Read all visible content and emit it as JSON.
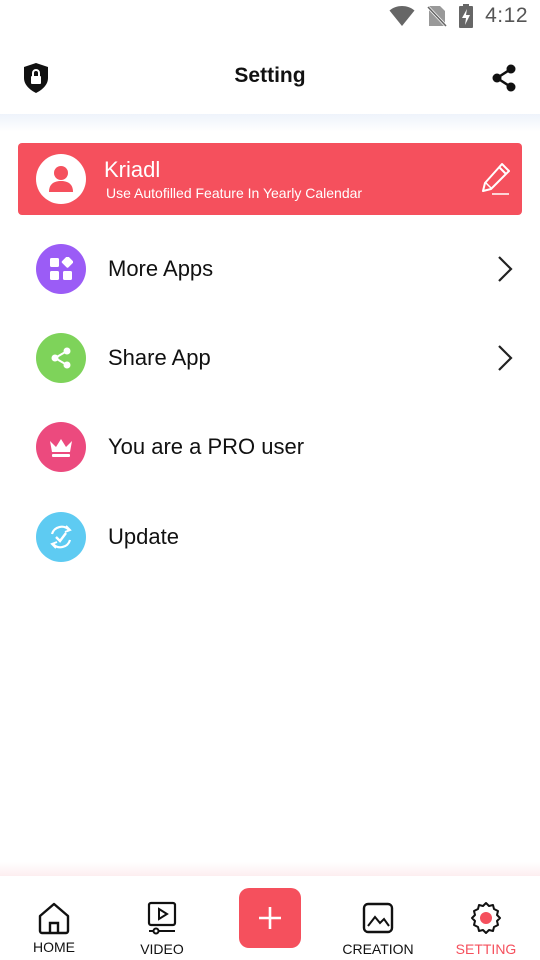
{
  "status_bar": {
    "time": "4:12"
  },
  "app_bar": {
    "title": "Setting"
  },
  "profile": {
    "name": "Kriadl",
    "subtitle": "Use Autofilled Feature In Yearly Calendar"
  },
  "menu": [
    {
      "label": "More Apps",
      "icon": "apps-grid-icon",
      "color": "#9b5cf6",
      "chevron": true
    },
    {
      "label": "Share App",
      "icon": "share-icon",
      "color": "#7ed35a",
      "chevron": true
    },
    {
      "label": "You are a PRO user",
      "icon": "crown-icon",
      "color": "#ec4a7e",
      "chevron": false
    },
    {
      "label": "Update",
      "icon": "update-check-icon",
      "color": "#5ecbf2",
      "chevron": false
    }
  ],
  "bottom_nav": [
    {
      "label": "HOME",
      "icon": "home-icon",
      "active": false
    },
    {
      "label": "VIDEO",
      "icon": "video-icon",
      "active": false
    },
    {
      "label": "CREATION",
      "icon": "image-icon",
      "active": false
    },
    {
      "label": "SETTING",
      "icon": "gear-icon",
      "active": true
    }
  ],
  "colors": {
    "accent": "#f5505d",
    "text": "#111111"
  }
}
